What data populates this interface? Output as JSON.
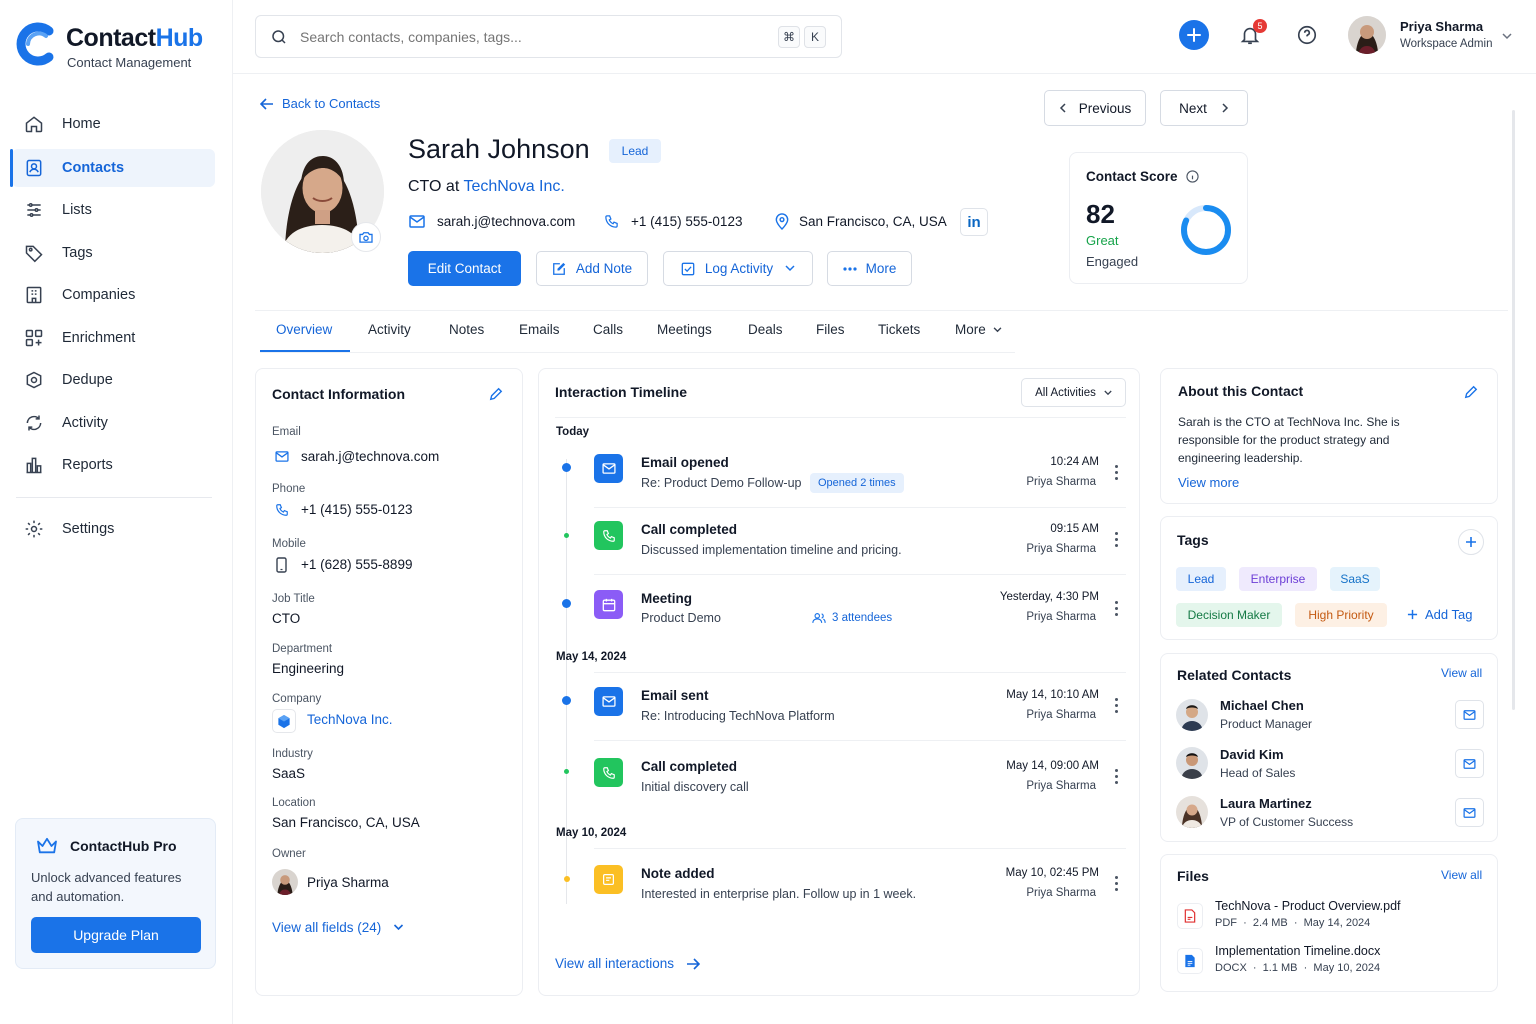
{
  "app": {
    "name_part1": "Contact",
    "name_part2": "Hub",
    "subtitle": "Contact Management"
  },
  "sidebar": {
    "items": [
      {
        "label": "Home",
        "icon": "home-icon"
      },
      {
        "label": "Contacts",
        "icon": "contacts-icon",
        "active": true
      },
      {
        "label": "Lists",
        "icon": "lists-icon"
      },
      {
        "label": "Tags",
        "icon": "tag-icon"
      },
      {
        "label": "Companies",
        "icon": "building-icon"
      },
      {
        "label": "Enrichment",
        "icon": "enrichment-icon"
      },
      {
        "label": "Dedupe",
        "icon": "dedupe-icon"
      },
      {
        "label": "Activity",
        "icon": "activity-icon"
      },
      {
        "label": "Reports",
        "icon": "reports-icon"
      }
    ],
    "settings_label": "Settings",
    "pro": {
      "title": "ContactHub Pro",
      "text": "Unlock advanced features and automation.",
      "button": "Upgrade Plan"
    }
  },
  "header": {
    "search_placeholder": "Search contacts, companies, tags...",
    "shortcut_cmd": "⌘",
    "shortcut_key": "K",
    "notification_count": "5",
    "user_name": "Priya Sharma",
    "user_role": "Workspace Admin"
  },
  "contact": {
    "back_label": "Back to Contacts",
    "prev_label": "Previous",
    "next_label": "Next",
    "name": "Sarah Johnson",
    "badge": "Lead",
    "title_prefix": "CTO at",
    "company": "TechNova Inc.",
    "email": "sarah.j@technova.com",
    "phone": "+1 (415) 555-0123",
    "location": "San Francisco, CA, USA",
    "actions": {
      "edit": "Edit Contact",
      "note": "Add Note",
      "log": "Log Activity",
      "more": "More"
    },
    "score": {
      "label": "Contact Score",
      "value": "82",
      "rating": "Great",
      "status": "Engaged",
      "fraction": 0.82
    }
  },
  "tabs": [
    "Overview",
    "Activity",
    "Notes",
    "Emails",
    "Calls",
    "Meetings",
    "Deals",
    "Files",
    "Tickets",
    "More"
  ],
  "info": {
    "title": "Contact Information",
    "fields": {
      "email_label": "Email",
      "email": "sarah.j@technova.com",
      "phone_label": "Phone",
      "phone": "+1 (415) 555-0123",
      "mobile_label": "Mobile",
      "mobile": "+1 (628) 555-8899",
      "job_label": "Job Title",
      "job": "CTO",
      "dept_label": "Department",
      "dept": "Engineering",
      "company_label": "Company",
      "company": "TechNova Inc.",
      "industry_label": "Industry",
      "industry": "SaaS",
      "location_label": "Location",
      "location": "San Francisco, CA, USA",
      "owner_label": "Owner",
      "owner": "Priya Sharma"
    },
    "view_all": "View all fields (24)"
  },
  "timeline": {
    "title": "Interaction Timeline",
    "filter": "All Activities",
    "groups": [
      "Today",
      "May 14, 2024",
      "May 10, 2024"
    ],
    "items": [
      {
        "type": "email",
        "title": "Email opened",
        "sub": "Re: Product Demo Follow-up",
        "badge": "Opened 2 times",
        "time": "10:24 AM",
        "by": "Priya Sharma"
      },
      {
        "type": "call",
        "title": "Call completed",
        "sub": "Discussed implementation timeline and pricing.",
        "time": "09:15 AM",
        "by": "Priya Sharma"
      },
      {
        "type": "meeting",
        "title": "Meeting",
        "sub": "Product Demo",
        "extra": "3 attendees",
        "time": "Yesterday, 4:30 PM",
        "by": "Priya Sharma"
      },
      {
        "type": "email",
        "title": "Email sent",
        "sub": "Re: Introducing TechNova Platform",
        "time": "May 14, 10:10 AM",
        "by": "Priya Sharma"
      },
      {
        "type": "call",
        "title": "Call completed",
        "sub": "Initial discovery call",
        "time": "May 14, 09:00 AM",
        "by": "Priya Sharma"
      },
      {
        "type": "note",
        "title": "Note added",
        "sub": "Interested in enterprise plan. Follow up in 1 week.",
        "time": "May 10, 02:45 PM",
        "by": "Priya Sharma"
      }
    ],
    "view_all": "View all interactions"
  },
  "about": {
    "title": "About this Contact",
    "text": "Sarah is the CTO at TechNova Inc. She is responsible for the product strategy and engineering leadership.",
    "more": "View more"
  },
  "tags": {
    "title": "Tags",
    "list": [
      {
        "label": "Lead",
        "bg": "#e6f0fd",
        "fg": "#1565d8"
      },
      {
        "label": "Enterprise",
        "bg": "#efeafd",
        "fg": "#6d3fd6"
      },
      {
        "label": "SaaS",
        "bg": "#e5f3fc",
        "fg": "#1673c8"
      },
      {
        "label": "Decision Maker",
        "bg": "#e4f6ec",
        "fg": "#157a45"
      },
      {
        "label": "High Priority",
        "bg": "#fdf0e4",
        "fg": "#c45a12"
      }
    ],
    "add": "Add Tag"
  },
  "related": {
    "title": "Related Contacts",
    "view_all": "View all",
    "people": [
      {
        "name": "Michael Chen",
        "role": "Product Manager"
      },
      {
        "name": "David Kim",
        "role": "Head of Sales"
      },
      {
        "name": "Laura Martinez",
        "role": "VP of Customer Success"
      }
    ]
  },
  "files": {
    "title": "Files",
    "view_all": "View all",
    "list": [
      {
        "name": "TechNova - Product Overview.pdf",
        "type": "PDF",
        "size": "2.4 MB",
        "date": "May 14, 2024"
      },
      {
        "name": "Implementation Timeline.docx",
        "type": "DOCX",
        "size": "1.1 MB",
        "date": "May 10, 2024"
      }
    ]
  },
  "colors": {
    "accent": "#1a73e8",
    "call": "#22c55e",
    "meeting": "#8b5cf6",
    "note": "#fbbf24"
  }
}
